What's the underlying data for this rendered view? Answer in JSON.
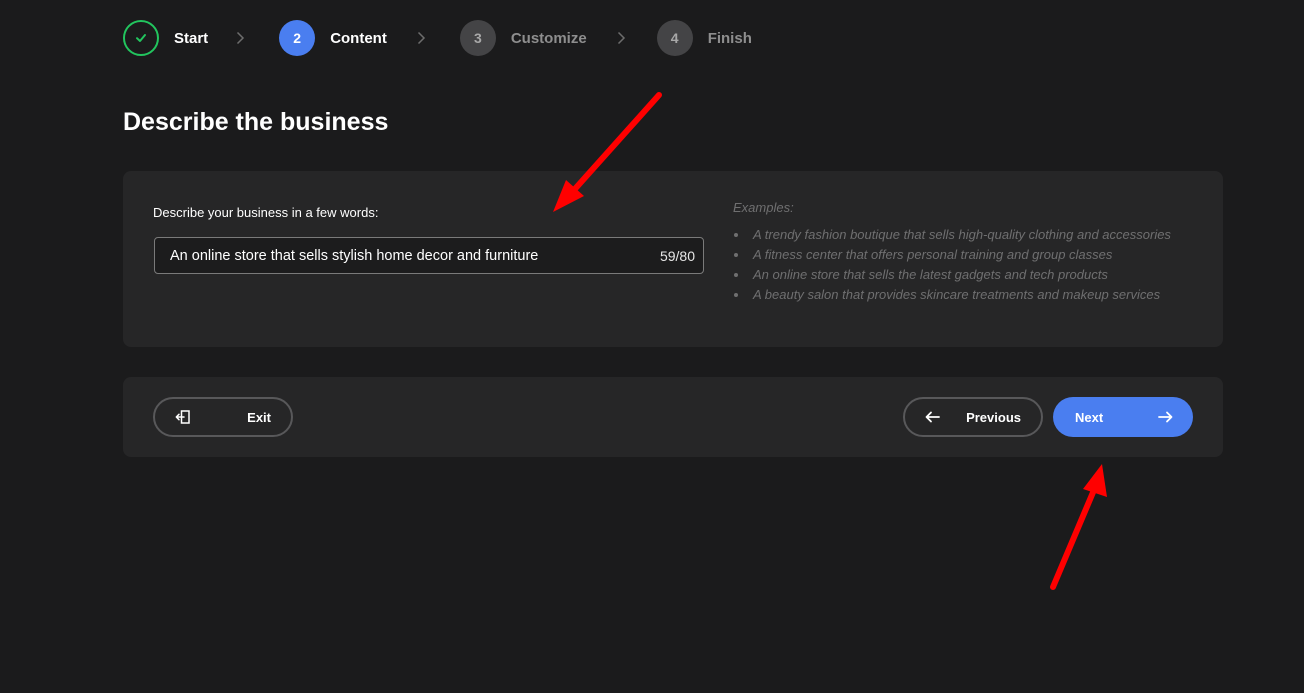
{
  "stepper": {
    "steps": [
      {
        "number": "",
        "label": "Start",
        "state": "done"
      },
      {
        "number": "2",
        "label": "Content",
        "state": "active"
      },
      {
        "number": "3",
        "label": "Customize",
        "state": "pending"
      },
      {
        "number": "4",
        "label": "Finish",
        "state": "pending"
      }
    ]
  },
  "page": {
    "title": "Describe the business"
  },
  "form": {
    "field_label": "Describe your business in a few words:",
    "value": "An online store that sells stylish home decor and furniture",
    "char_count": "59/80"
  },
  "examples": {
    "heading": "Examples:",
    "items": [
      "A trendy fashion boutique that sells high-quality clothing and accessories",
      "A fitness center that offers personal training and group classes",
      "An online store that sells the latest gadgets and tech products",
      "A beauty salon that provides skincare treatments and makeup services"
    ]
  },
  "actions": {
    "exit_label": "Exit",
    "previous_label": "Previous",
    "next_label": "Next"
  },
  "colors": {
    "background": "#1b1b1c",
    "card": "#262627",
    "accent": "#4a7ef0",
    "done": "#22c55e",
    "annotation": "#ff0000"
  }
}
